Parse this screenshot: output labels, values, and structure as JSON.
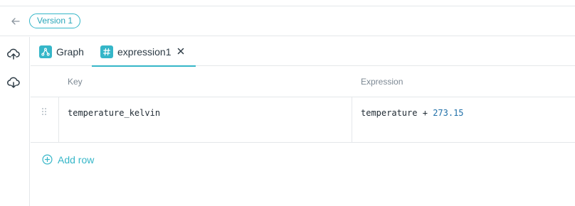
{
  "header": {
    "back_icon": "arrow-left-icon",
    "version_label": "Version 1"
  },
  "left_rail": {
    "items": [
      {
        "icon": "cloud-upload-icon"
      },
      {
        "icon": "cloud-download-icon"
      }
    ]
  },
  "tabs": [
    {
      "label": "Graph",
      "icon": "graph-icon",
      "active": false
    },
    {
      "label": "expression1",
      "icon": "hash-icon",
      "active": true,
      "closable": true
    }
  ],
  "table": {
    "columns": [
      "Key",
      "Expression"
    ],
    "rows": [
      {
        "key": "temperature_kelvin",
        "expression": {
          "variable": "temperature",
          "operator": "+",
          "constant": "273.15"
        }
      }
    ]
  },
  "actions": {
    "add_row_label": "Add row"
  },
  "colors": {
    "accent": "#35b6c8",
    "border": "#e4e7ea",
    "number": "#1f6fa8"
  }
}
